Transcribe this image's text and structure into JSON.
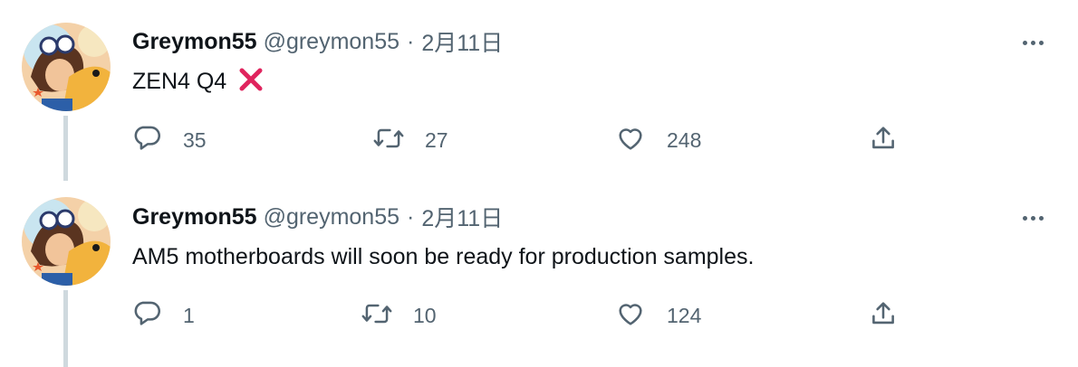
{
  "tweets": [
    {
      "author": {
        "name": "Greymon55",
        "handle": "@greymon55"
      },
      "separator": "·",
      "date": "2月11日",
      "text": "ZEN4 Q4",
      "emoji": "cross-mark",
      "stats": {
        "replies": "35",
        "retweets": "27",
        "likes": "248"
      }
    },
    {
      "author": {
        "name": "Greymon55",
        "handle": "@greymon55"
      },
      "separator": "·",
      "date": "2月11日",
      "text": "AM5 motherboards will soon be ready for production samples.",
      "stats": {
        "replies": "1",
        "retweets": "10",
        "likes": "124"
      }
    }
  ],
  "icons": {
    "reply": "reply-icon",
    "retweet": "retweet-icon",
    "like": "heart-icon",
    "share": "share-icon",
    "more": "more-icon"
  },
  "colors": {
    "text": "#0f1419",
    "secondary": "#536471",
    "thread_line": "#cfd9de",
    "cross": "#e0245e"
  }
}
